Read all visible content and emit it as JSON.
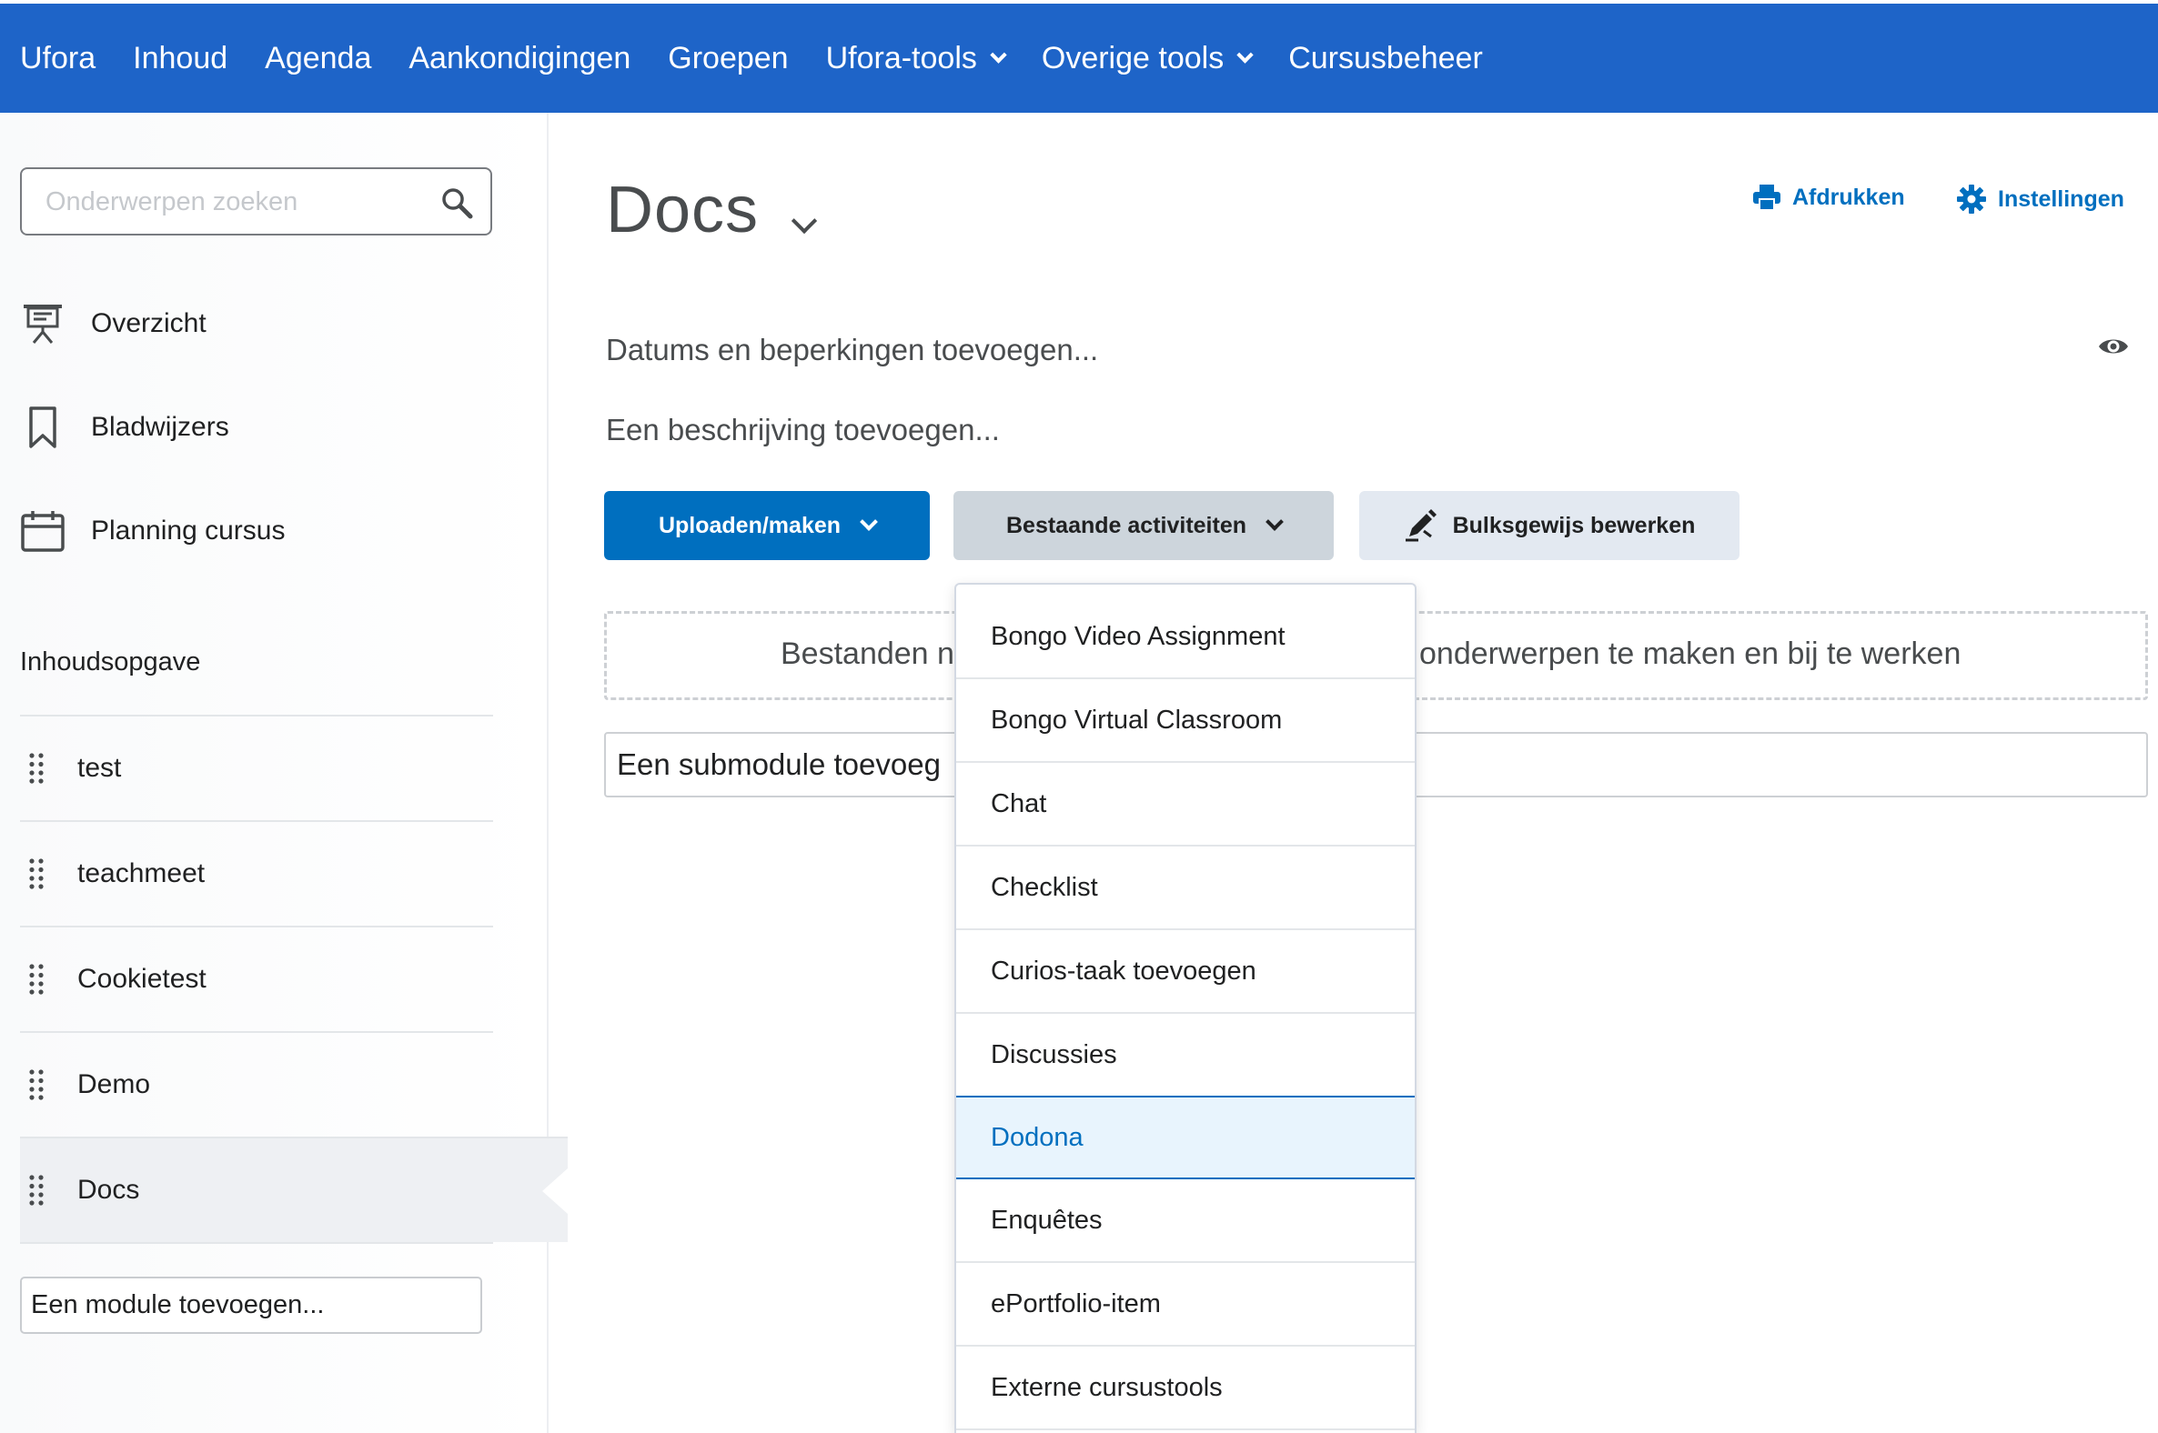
{
  "topnav": {
    "items": [
      {
        "label": "Ufora",
        "dropdown": false
      },
      {
        "label": "Inhoud",
        "dropdown": false
      },
      {
        "label": "Agenda",
        "dropdown": false
      },
      {
        "label": "Aankondigingen",
        "dropdown": false
      },
      {
        "label": "Groepen",
        "dropdown": false
      },
      {
        "label": "Ufora-tools",
        "dropdown": true
      },
      {
        "label": "Overige tools",
        "dropdown": true
      },
      {
        "label": "Cursusbeheer",
        "dropdown": false
      }
    ],
    "background": "#1e64c8"
  },
  "sidebar": {
    "search_placeholder": "Onderwerpen zoeken",
    "links": [
      {
        "label": "Overzicht",
        "icon": "presentation-icon"
      },
      {
        "label": "Bladwijzers",
        "icon": "bookmark-icon"
      },
      {
        "label": "Planning cursus",
        "icon": "calendar-icon"
      }
    ],
    "toc_heading": "Inhoudsopgave",
    "toc_items": [
      {
        "label": "test",
        "active": false
      },
      {
        "label": "teachmeet",
        "active": false
      },
      {
        "label": "Cookietest",
        "active": false
      },
      {
        "label": "Demo",
        "active": false
      },
      {
        "label": "Docs",
        "active": true
      }
    ],
    "add_module": "Een module toevoegen..."
  },
  "main": {
    "title": "Docs",
    "print_label": "Afdrukken",
    "settings_label": "Instellingen",
    "dates_link": "Datums en beperkingen toevoegen...",
    "description_link": "Een beschrijving toevoegen...",
    "buttons": {
      "upload": "Uploaden/maken",
      "existing": "Bestaande activiteiten",
      "bulk": "Bulksgewijs bewerken"
    },
    "drop_zone_left": "Bestanden n",
    "drop_zone_right": "onderwerpen te maken en bij te werken",
    "add_submodule": "Een submodule toevoeg"
  },
  "dropdown_menu": {
    "items": [
      {
        "label": "Bongo Video Assignment",
        "selected": false
      },
      {
        "label": "Bongo Virtual Classroom",
        "selected": false
      },
      {
        "label": "Chat",
        "selected": false
      },
      {
        "label": "Checklist",
        "selected": false
      },
      {
        "label": "Curios-taak toevoegen",
        "selected": false
      },
      {
        "label": "Discussies",
        "selected": false
      },
      {
        "label": "Dodona",
        "selected": true
      },
      {
        "label": "Enquêtes",
        "selected": false
      },
      {
        "label": "ePortfolio-item",
        "selected": false
      },
      {
        "label": "Externe cursustools",
        "selected": false
      }
    ]
  },
  "colors": {
    "accent": "#006fbf",
    "nav": "#1e64c8",
    "selected_bg": "#e8f4fd"
  }
}
